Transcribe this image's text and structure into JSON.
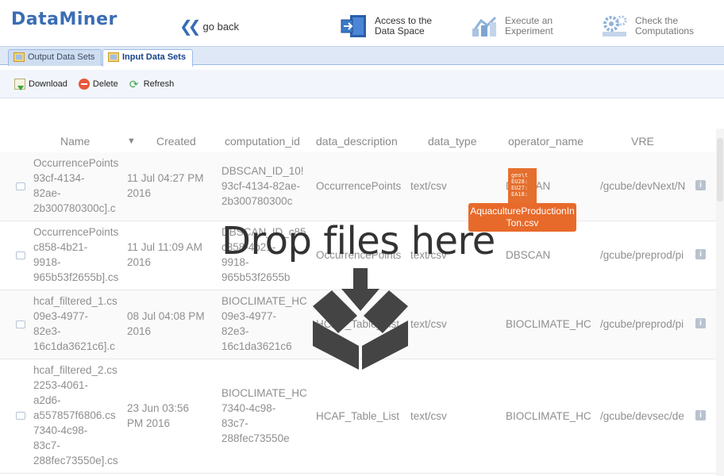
{
  "app": {
    "logo": "DataMiner",
    "go_back": "go back",
    "nav": [
      {
        "label_line1": "Access to the",
        "label_line2": "Data Space",
        "icon": "data-space-icon"
      },
      {
        "label_line1": "Execute an",
        "label_line2": "Experiment",
        "icon": "experiment-icon"
      },
      {
        "label_line1": "Check the",
        "label_line2": "Computations",
        "icon": "computations-icon"
      }
    ]
  },
  "tabs": [
    {
      "label": "Output Data Sets",
      "active": false
    },
    {
      "label": "Input Data Sets",
      "active": true
    }
  ],
  "toolbar": {
    "download": "Download",
    "delete": "Delete",
    "refresh": "Refresh"
  },
  "grid": {
    "columns": [
      "Name",
      "Created",
      "computation_id",
      "data_description",
      "data_type",
      "operator_name",
      "VRE"
    ],
    "rows": [
      {
        "name": [
          "OccurrencePoints",
          "93cf-4134-",
          "82ae-",
          "2b300780300c].c"
        ],
        "created": [
          "11 Jul 04:27 PM",
          "2016"
        ],
        "computation_id": [
          "DBSCAN_ID_10!",
          "93cf-4134-82ae-",
          "2b300780300c"
        ],
        "data_description": "OccurrencePoints",
        "data_type": "text/csv",
        "operator_name": "DBSCAN",
        "vre": "/gcube/devNext/N"
      },
      {
        "name": [
          "OccurrencePoints",
          "c858-4b21-",
          "9918-",
          "965b53f2655b].cs"
        ],
        "created": [
          "11 Jul 11:09 AM",
          "2016"
        ],
        "computation_id": [
          "DBSCAN_ID_c85",
          "c858-4b21-",
          "9918-",
          "965b53f2655b"
        ],
        "data_description": "OccurrencePoints",
        "data_type": "text/csv",
        "operator_name": "DBSCAN",
        "vre": "/gcube/preprod/pi"
      },
      {
        "name": [
          "hcaf_filtered_1.cs",
          "09e3-4977-",
          "82e3-",
          "16c1da3621c6].c"
        ],
        "created": [
          "08 Jul 04:08 PM",
          "2016"
        ],
        "computation_id": [
          "BIOCLIMATE_HC",
          "09e3-4977-",
          "82e3-",
          "16c1da3621c6"
        ],
        "data_description": "HCAF_Table_List",
        "data_type": "text/csv",
        "operator_name": "BIOCLIMATE_HC",
        "vre": "/gcube/preprod/pi"
      },
      {
        "name": [
          "hcaf_filtered_2.cs",
          "2253-4061-",
          "a2d6-",
          "a557857f6806.cs",
          "7340-4c98-",
          "83c7-",
          "288fec73550e].cs"
        ],
        "created": [
          "23 Jun 03:56",
          "PM 2016"
        ],
        "computation_id": [
          "BIOCLIMATE_HC",
          "7340-4c98-",
          "83c7-",
          "288fec73550e"
        ],
        "data_description": "HCAF_Table_List",
        "data_type": "text/csv",
        "operator_name": "BIOCLIMATE_HC",
        "vre": "/gcube/devsec/de"
      }
    ]
  },
  "drop_overlay": {
    "message": "Drop files here",
    "dragged_file": "AquacultureProductionInTon.csv",
    "file_preview": "geo\\t\nEU28:\nEU27:\nEA18:"
  },
  "colors": {
    "brand": "#3a6db5",
    "drag_file": "#e86a2a",
    "drop_icon": "#444444"
  }
}
